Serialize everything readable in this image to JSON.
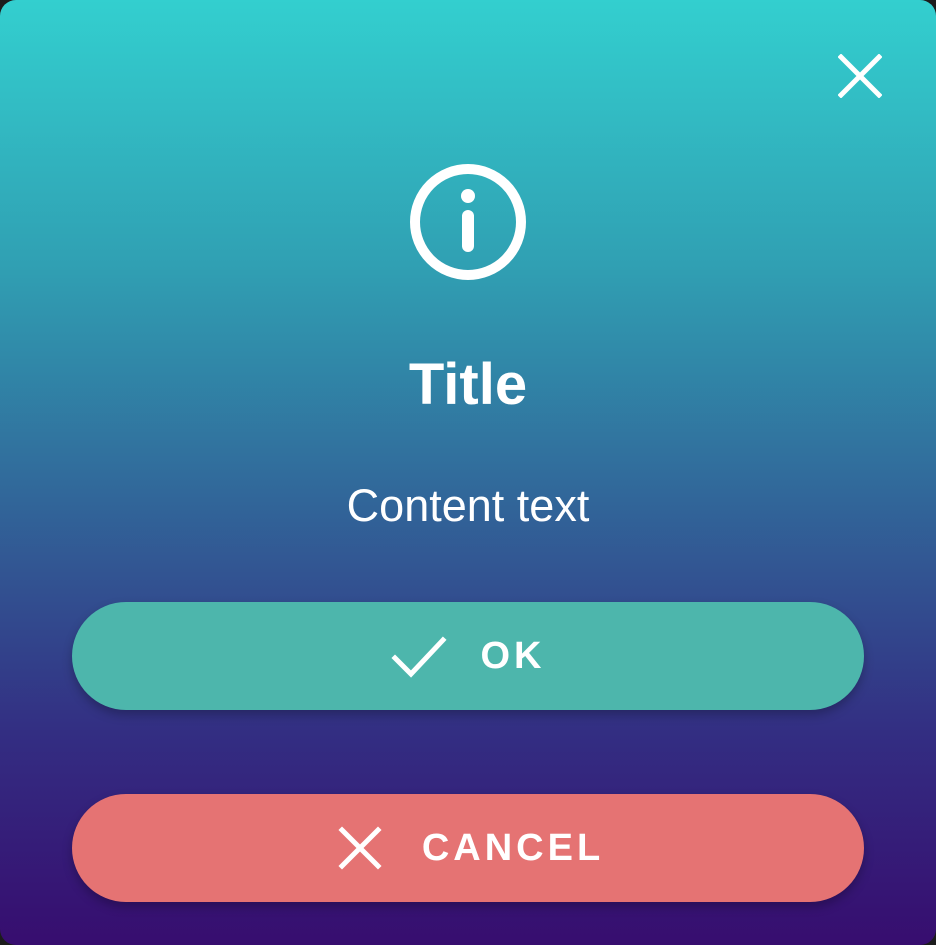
{
  "dialog": {
    "title": "Title",
    "content": "Content text",
    "close_icon": "close-icon",
    "info_icon": "info-icon",
    "ok_button": {
      "label": "OK",
      "icon": "check-icon",
      "color": "#4db6ac"
    },
    "cancel_button": {
      "label": "CANCEL",
      "icon": "close-icon",
      "color": "#e57373"
    },
    "gradient": {
      "top": "#33cfcf",
      "bottom": "#370d6f"
    }
  }
}
